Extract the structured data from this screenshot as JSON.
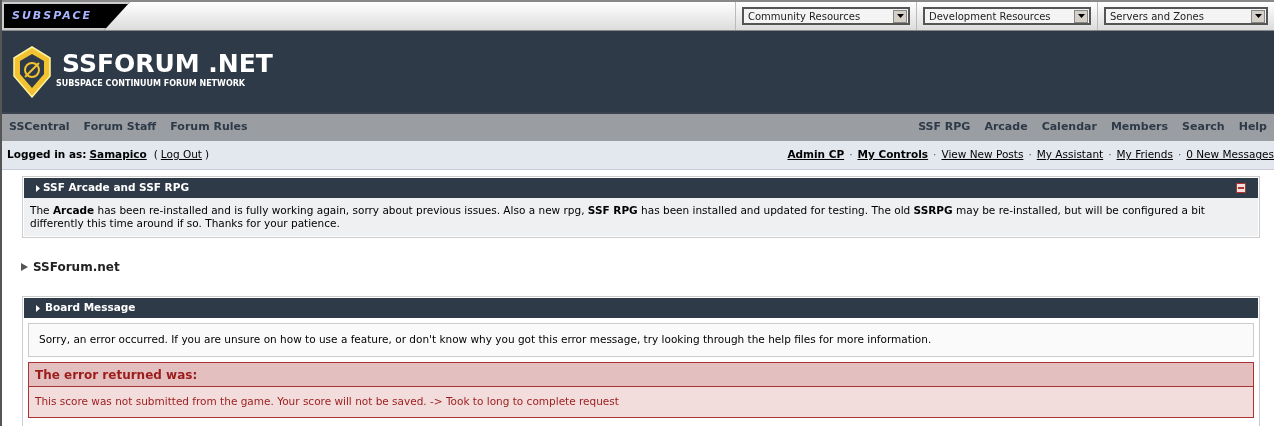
{
  "top_bar": {
    "logo": "SUBSPACE",
    "dropdowns": [
      {
        "value": "Community Resources"
      },
      {
        "value": "Development Resources"
      },
      {
        "value": "Servers and Zones"
      }
    ]
  },
  "header": {
    "title": "SSFORUM .NET",
    "tagline": "SUBSPACE CONTINUUM FORUM NETWORK"
  },
  "nav_left": [
    "SSCentral",
    "Forum Staff",
    "Forum Rules"
  ],
  "nav_right": [
    "SSF RPG",
    "Arcade",
    "Calendar",
    "Members",
    "Search",
    "Help"
  ],
  "user_bar": {
    "label": "Logged in as:",
    "user": "Samapico",
    "open_paren": "(",
    "logout": "Log Out",
    "close_paren": ")",
    "links": [
      {
        "text": "Admin CP",
        "bold": true
      },
      {
        "text": "My Controls",
        "bold": true
      },
      {
        "text": "View New Posts",
        "bold": false
      },
      {
        "text": "My Assistant",
        "bold": false
      },
      {
        "text": "My Friends",
        "bold": false
      },
      {
        "text": "0 New Messages",
        "bold": false
      }
    ],
    "separator": "·"
  },
  "announcement": {
    "title": "SSF Arcade and SSF RPG",
    "expanded": true,
    "text": "The **Arcade** has been re-installed and is fully working again, sorry about previous issues. Also a new rpg, **SSF RPG** has been installed and updated for testing. The old **SSRPG** may be re-installed, but will be configured a bit differently this time around if so. Thanks for your patience."
  },
  "breadcrumb": "SSForum.net",
  "board_message": {
    "title": "Board Message",
    "message": "Sorry, an error occurred. If you are unsure on how to use a feature, or don't know why you got this error message, try looking through the help files for more information.",
    "error_title": "The error returned was:",
    "error_text": "This score was not submitted from the game. Your score will not be saved. -> Took to long to complete request"
  }
}
